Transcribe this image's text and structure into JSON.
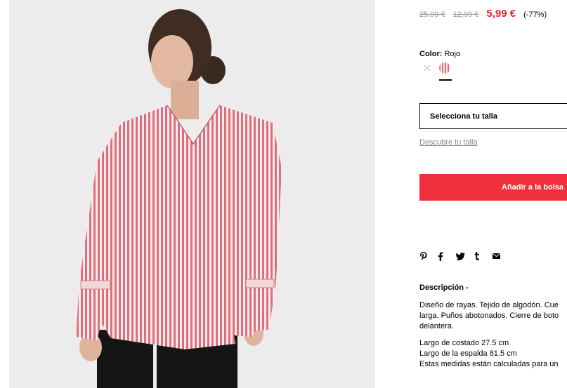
{
  "product": {
    "old_price_1": "25,99 €",
    "old_price_2": "12,99 €",
    "price": "5,99 €",
    "discount": "(-77%)"
  },
  "color": {
    "label": "Color:",
    "value": "Rojo"
  },
  "size": {
    "select_label": "Selecciona tu talla",
    "guide_link": "Descubre tu talla"
  },
  "cart": {
    "add_label": "Añadir a la bolsa"
  },
  "share": {
    "icons": [
      "pinterest-icon",
      "facebook-icon",
      "twitter-icon",
      "tumblr-icon",
      "email-icon"
    ]
  },
  "description": {
    "title": "Descripción -",
    "line_1": "Diseño de rayas. Tejido de algodón. Cue",
    "line_2": "larga. Puños abotonados. Cierre de boto",
    "line_3": "delantera.",
    "measure_1": "Largo de costado 27.5 cm",
    "measure_2": "Largo de la espalda 81.5 cm",
    "measure_3": "Estas medidas están calculadas para un"
  },
  "colors": {
    "sale_red": "#e8232f",
    "button_red": "#f0303a",
    "stripe_red": "#e6717b"
  }
}
